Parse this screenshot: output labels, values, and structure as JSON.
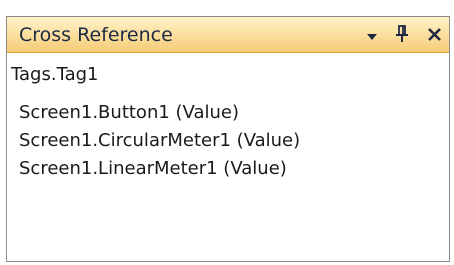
{
  "panel": {
    "title": "Cross Reference",
    "buttons": {
      "menu_icon": "dropdown-arrow-icon",
      "pin_icon": "pin-icon",
      "close_icon": "close-icon"
    },
    "tag": "Tags.Tag1",
    "references": [
      "Screen1.Button1 (Value)",
      "Screen1.CircularMeter1 (Value)",
      "Screen1.LinearMeter1 (Value)"
    ]
  },
  "colors": {
    "title_gradient_top": "#fff2c8",
    "title_gradient_bottom": "#f6cc78",
    "title_text": "#1e2a44",
    "border": "#8c8c8c"
  }
}
